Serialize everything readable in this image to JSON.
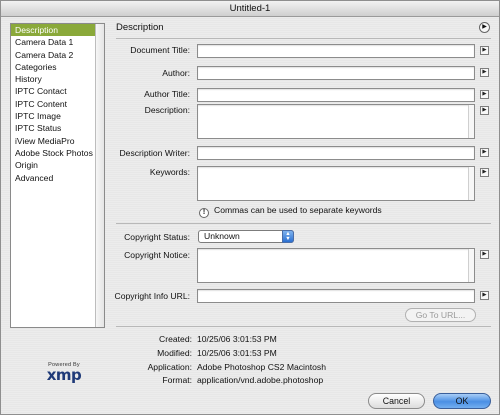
{
  "window": {
    "title": "Untitled-1"
  },
  "sidebar": {
    "items": [
      {
        "label": "Description",
        "selected": true
      },
      {
        "label": "Camera Data 1"
      },
      {
        "label": "Camera Data 2"
      },
      {
        "label": "Categories"
      },
      {
        "label": "History"
      },
      {
        "label": "IPTC Contact"
      },
      {
        "label": "IPTC Content"
      },
      {
        "label": "IPTC Image"
      },
      {
        "label": "IPTC Status"
      },
      {
        "label": "iView MediaPro"
      },
      {
        "label": "Adobe Stock Photos"
      },
      {
        "label": "Origin"
      },
      {
        "label": "Advanced"
      }
    ],
    "selected_color": "#8aa93a"
  },
  "branding": {
    "powered_by": "Powered By",
    "logo_text": "xmp"
  },
  "panel": {
    "title": "Description",
    "fields": {
      "document_title": {
        "label": "Document Title:",
        "value": ""
      },
      "author": {
        "label": "Author:",
        "value": ""
      },
      "author_title": {
        "label": "Author Title:",
        "value": ""
      },
      "description": {
        "label": "Description:",
        "value": ""
      },
      "description_writer": {
        "label": "Description Writer:",
        "value": ""
      },
      "keywords": {
        "label": "Keywords:",
        "value": ""
      },
      "copyright_status": {
        "label": "Copyright Status:",
        "value": "Unknown"
      },
      "copyright_notice": {
        "label": "Copyright Notice:",
        "value": ""
      },
      "copyright_info_url": {
        "label": "Copyright Info URL:",
        "value": ""
      }
    },
    "keywords_hint": "Commas can be used to separate keywords",
    "goto_url_label": "Go To URL..."
  },
  "metadata": {
    "created": {
      "label": "Created:",
      "value": "10/25/06 3:01:53 PM"
    },
    "modified": {
      "label": "Modified:",
      "value": "10/25/06 3:01:53 PM"
    },
    "application": {
      "label": "Application:",
      "value": "Adobe Photoshop CS2 Macintosh"
    },
    "format": {
      "label": "Format:",
      "value": "application/vnd.adobe.photoshop"
    }
  },
  "buttons": {
    "cancel": "Cancel",
    "ok": "OK"
  },
  "icons": {
    "panel_menu": "circle-arrow-icon",
    "field_menu": "right-triangle-icon",
    "info": "info-icon",
    "select_arrows": "updown-arrows-icon"
  }
}
